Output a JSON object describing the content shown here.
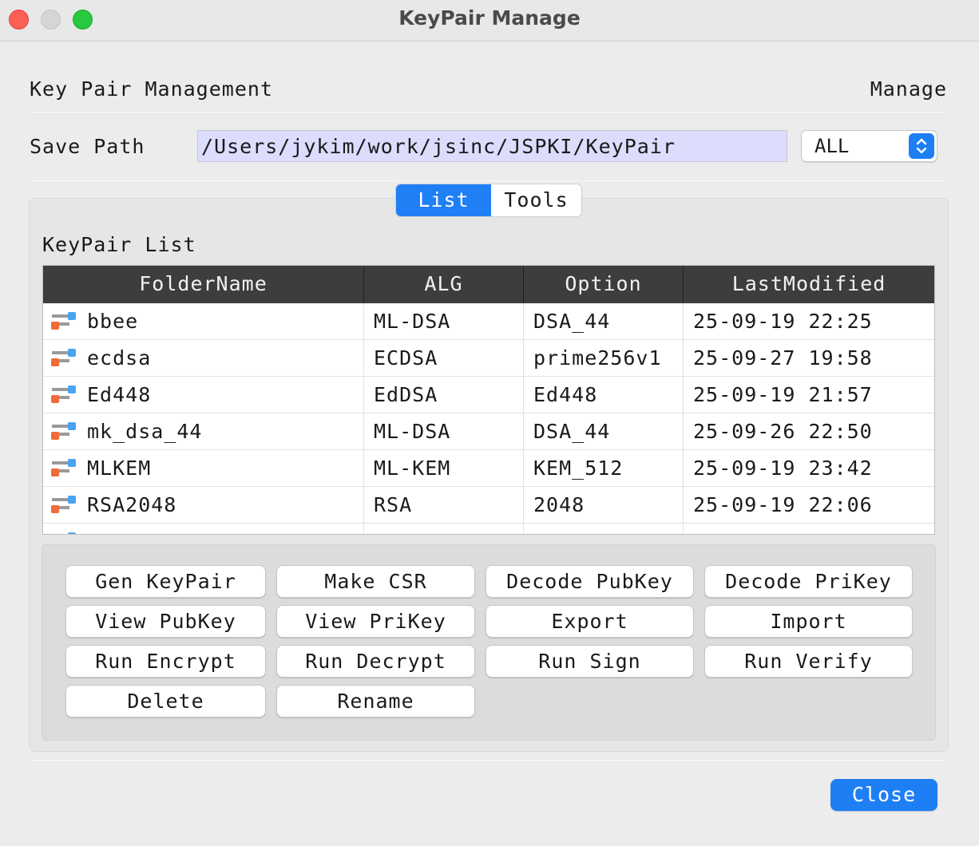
{
  "window": {
    "title": "KeyPair Manage"
  },
  "header": {
    "title": "Key Pair Management",
    "right_label": "Manage"
  },
  "save_path": {
    "label": "Save Path",
    "value": "/Users/jykim/work/jsinc/JSPKI/KeyPair",
    "filter_value": "ALL"
  },
  "tabs": [
    {
      "label": "List",
      "active": true
    },
    {
      "label": "Tools",
      "active": false
    }
  ],
  "list": {
    "title": "KeyPair List",
    "columns": [
      "FolderName",
      "ALG",
      "Option",
      "LastModified"
    ],
    "rows": [
      {
        "folder": "bbee",
        "alg": "ML-DSA",
        "option": "DSA_44",
        "modified": "25-09-19 22:25"
      },
      {
        "folder": "ecdsa",
        "alg": "ECDSA",
        "option": "prime256v1",
        "modified": "25-09-27 19:58"
      },
      {
        "folder": "Ed448",
        "alg": "EdDSA",
        "option": "Ed448",
        "modified": "25-09-19 21:57"
      },
      {
        "folder": "mk_dsa_44",
        "alg": "ML-DSA",
        "option": "DSA_44",
        "modified": "25-09-26 22:50"
      },
      {
        "folder": "MLKEM",
        "alg": "ML-KEM",
        "option": "KEM_512",
        "modified": "25-09-19 23:42"
      },
      {
        "folder": "RSA2048",
        "alg": "RSA",
        "option": "2048",
        "modified": "25-09-19 22:06"
      }
    ]
  },
  "actions": {
    "gen_keypair": "Gen KeyPair",
    "make_csr": "Make CSR",
    "decode_pubkey": "Decode PubKey",
    "decode_prikey": "Decode PriKey",
    "view_pubkey": "View PubKey",
    "view_prikey": "View PriKey",
    "export": "Export",
    "import": "Import",
    "run_encrypt": "Run Encrypt",
    "run_decrypt": "Run Decrypt",
    "run_sign": "Run Sign",
    "run_verify": "Run Verify",
    "delete": "Delete",
    "rename": "Rename"
  },
  "footer": {
    "close": "Close"
  },
  "colors": {
    "accent": "#1e7ff5",
    "path_bg": "#dcdcfc",
    "table_header": "#3d3d3d"
  }
}
